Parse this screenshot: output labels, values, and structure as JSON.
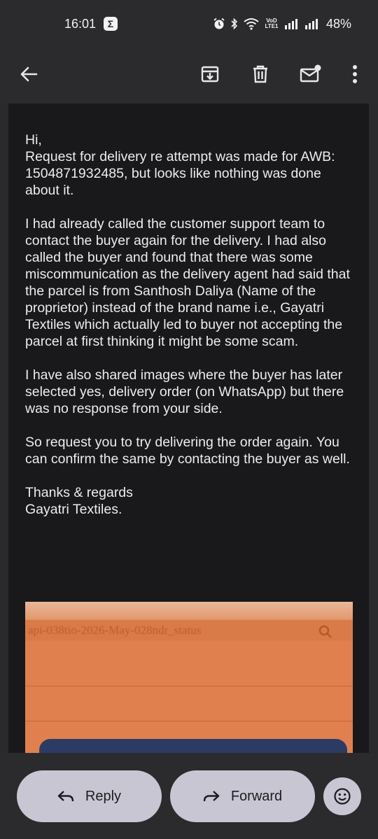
{
  "status_bar": {
    "time": "16:01",
    "notification_icon": "sigma-icon",
    "volte_label": "VoD LTE1",
    "battery": "48%"
  },
  "toolbar": {
    "back_icon": "arrow-left-icon",
    "archive_icon": "archive-icon",
    "delete_icon": "trash-icon",
    "mark_unread_icon": "mail-unread-icon",
    "more_icon": "more-vert-icon"
  },
  "email": {
    "paragraphs": [
      "Hi,\nRequest for delivery re attempt was made for AWB: 1504871932485, but looks like nothing was done about it.",
      "I had already called the customer support team to contact the buyer again for the delivery. I had also called the buyer and found that there was some miscommunication as the delivery agent had said that the parcel is from Santhosh Daliya (Name of the proprietor) instead of the brand name i.e., Gayatri Textiles which actually led to buyer not accepting the parcel at first thinking it might be some scam.",
      "I have also shared images where the buyer has later selected yes, delivery order (on WhatsApp) but there was no response from your side.",
      "So request you to try delivering the order again. You can confirm the same by contacting the buyer as well.",
      "Thanks & regards\nGayatri Textiles."
    ],
    "attachment": {
      "url_text": "api-038tio-2026-May-028ndr_status"
    }
  },
  "actions": {
    "reply_label": "Reply",
    "forward_label": "Forward",
    "reply_icon": "reply-icon",
    "forward_icon": "forward-icon",
    "emoji_icon": "emoji-icon"
  },
  "colors": {
    "background": "#19191b",
    "bar": "#2b2b2d",
    "pill": "#c9c6d3"
  }
}
